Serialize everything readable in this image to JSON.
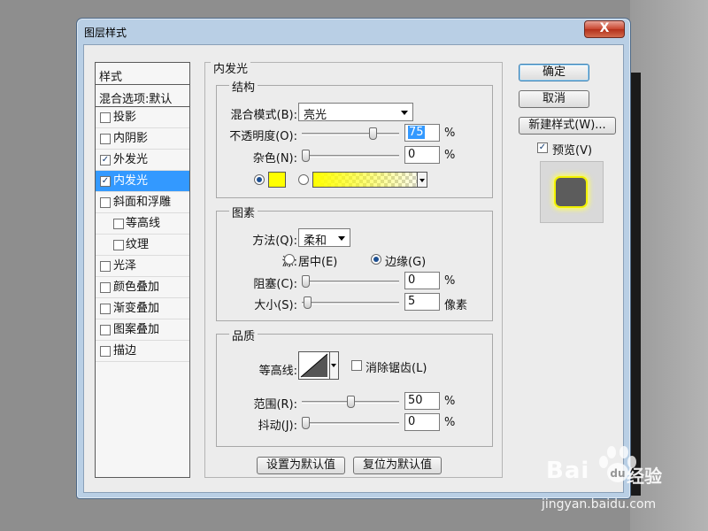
{
  "window": {
    "title": "图层样式",
    "close_label": "X"
  },
  "style_list": {
    "header": "样式",
    "blend_options": "混合选项:默认",
    "items": [
      {
        "label": "投影",
        "checked": false,
        "indent": false,
        "selected": false
      },
      {
        "label": "内阴影",
        "checked": false,
        "indent": false,
        "selected": false
      },
      {
        "label": "外发光",
        "checked": true,
        "indent": false,
        "selected": false
      },
      {
        "label": "内发光",
        "checked": true,
        "indent": false,
        "selected": true
      },
      {
        "label": "斜面和浮雕",
        "checked": false,
        "indent": false,
        "selected": false
      },
      {
        "label": "等高线",
        "checked": false,
        "indent": true,
        "selected": false
      },
      {
        "label": "纹理",
        "checked": false,
        "indent": true,
        "selected": false
      },
      {
        "label": "光泽",
        "checked": false,
        "indent": false,
        "selected": false
      },
      {
        "label": "颜色叠加",
        "checked": false,
        "indent": false,
        "selected": false
      },
      {
        "label": "渐变叠加",
        "checked": false,
        "indent": false,
        "selected": false
      },
      {
        "label": "图案叠加",
        "checked": false,
        "indent": false,
        "selected": false
      },
      {
        "label": "描边",
        "checked": false,
        "indent": false,
        "selected": false
      }
    ]
  },
  "panel": {
    "title": "内发光",
    "structure": {
      "title": "结构",
      "blend_mode_label": "混合模式(B):",
      "blend_mode_value": "亮光",
      "opacity_label": "不透明度(O):",
      "opacity_value": "75",
      "opacity_unit": "%",
      "opacity_level": 0.75,
      "noise_label": "杂色(N):",
      "noise_value": "0",
      "noise_unit": "%",
      "noise_level": 0,
      "glow_color": "#ffff00"
    },
    "elements": {
      "title": "图素",
      "technique_label": "方法(Q):",
      "technique_value": "柔和",
      "source_label": "源:",
      "source_center": "居中(E)",
      "source_edge": "边缘(G)",
      "choke_label": "阻塞(C):",
      "choke_value": "0",
      "choke_unit": "%",
      "choke_level": 0,
      "size_label": "大小(S):",
      "size_value": "5",
      "size_unit": "像素",
      "size_level": 0.02
    },
    "quality": {
      "title": "品质",
      "contour_label": "等高线:",
      "antialias_label": "消除锯齿(L)",
      "range_label": "范围(R):",
      "range_value": "50",
      "range_unit": "%",
      "range_level": 0.5,
      "jitter_label": "抖动(J):",
      "jitter_value": "0",
      "jitter_unit": "%",
      "jitter_level": 0
    },
    "set_default_label": "设置为默认值",
    "reset_default_label": "复位为默认值"
  },
  "buttons": {
    "ok": "确定",
    "cancel": "取消",
    "new_style": "新建样式(W)...",
    "preview": "预览(V)"
  },
  "watermark": {
    "logo": "Bai",
    "logo_end": "经验",
    "url": "jingyan.baidu.com"
  }
}
